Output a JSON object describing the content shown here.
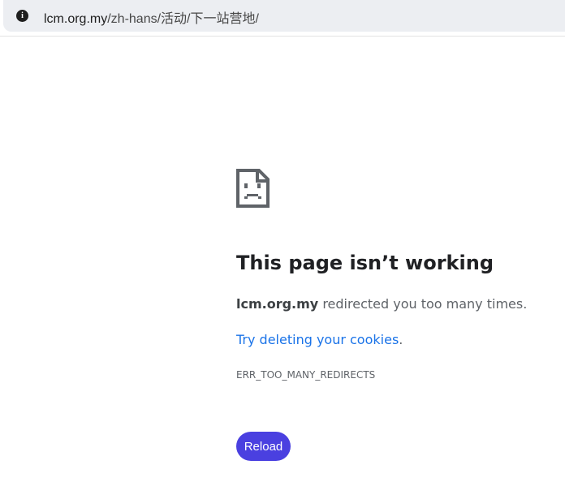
{
  "address_bar": {
    "host": "lcm.org.my",
    "path": "/zh-hans/活动/下一站营地/",
    "icon": "info-icon"
  },
  "error": {
    "icon": "sad-page-icon",
    "title": "This page isn’t working",
    "host": "lcm.org.my",
    "message": " redirected you too many times.",
    "link": "Try deleting your cookies",
    "link_suffix": ".",
    "code": "ERR_TOO_MANY_REDIRECTS",
    "reload_label": "Reload"
  },
  "colors": {
    "accent": "#4a40e0",
    "link": "#1a73e8"
  }
}
